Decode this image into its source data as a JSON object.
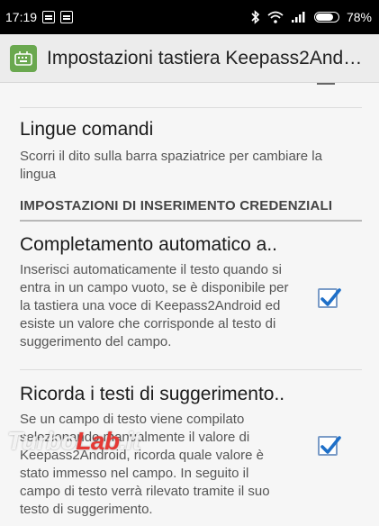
{
  "status_bar": {
    "time": "17:19",
    "battery": "78%",
    "battery_level": 0.78
  },
  "app_bar": {
    "title": "Impostazioni tastiera Keepass2And…",
    "icon": "keyboard-app-icon"
  },
  "preferences": [
    {
      "title": "Lingue comandi",
      "summary": "Scorri il dito sulla barra spaziatrice per cambiare la lingua"
    },
    {
      "section_header": "IMPOSTAZIONI DI INSERIMENTO CREDENZIALI"
    },
    {
      "title": "Completamento automatico a..",
      "summary": "Inserisci automaticamente il testo quando si entra in un campo vuoto, se è disponibile per la tastiera una voce di Keepass2Android ed esiste un valore che corrisponde al testo di suggerimento del campo.",
      "checked": true
    },
    {
      "title": "Ricorda i testi di suggerimento..",
      "summary": "Se un campo di testo viene compilato selezionando manualmente il valore di Keepass2Android, ricorda quale valore è stato immesso nel campo. In seguito il campo di testo verrà rilevato tramite il suo testo di suggerimento.",
      "checked": true
    }
  ],
  "watermark": {
    "text_main": "Turbo",
    "text_accent": "Lab",
    "text_end": ".it"
  },
  "colors": {
    "checkbox_border": "#7b9cc7",
    "checkmark": "#1e6fc8",
    "app_icon": "#6aa84f"
  }
}
